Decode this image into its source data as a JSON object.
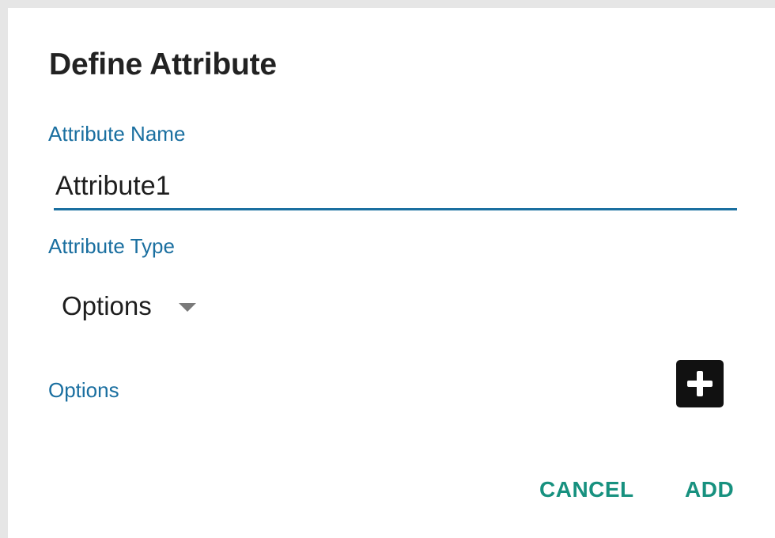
{
  "dialog": {
    "title": "Define Attribute",
    "name_label": "Attribute Name",
    "name_value": "Attribute1",
    "type_label": "Attribute Type",
    "type_value": "Options",
    "options_label": "Options",
    "cancel_label": "CANCEL",
    "add_label": "ADD"
  },
  "icons": {
    "dropdown": "caret-down-icon",
    "add_option": "plus-icon"
  },
  "colors": {
    "label_blue": "#1a6fa0",
    "action_teal": "#17917f",
    "add_button_bg": "#111111",
    "title_text": "#222222"
  }
}
